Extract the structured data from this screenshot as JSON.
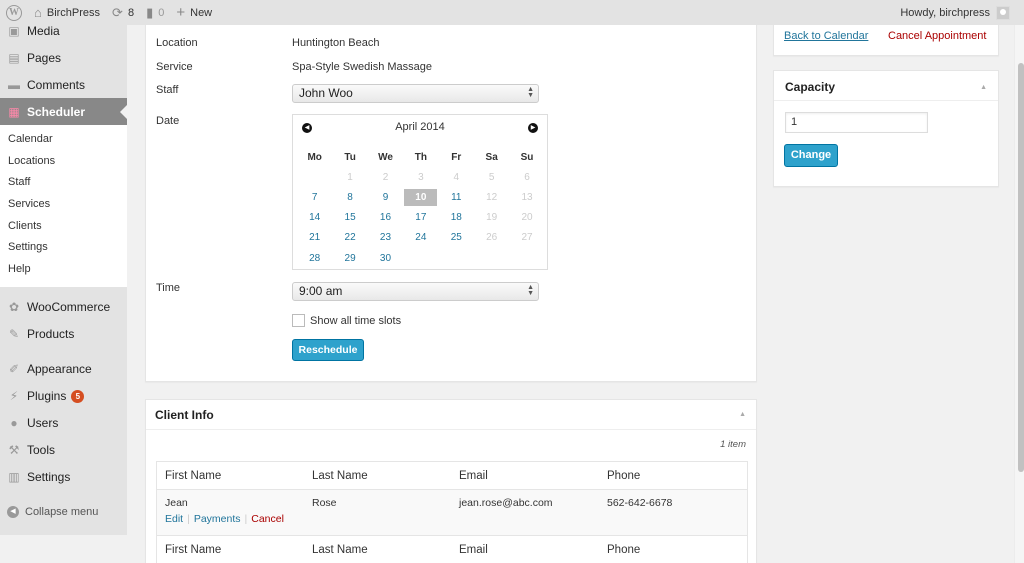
{
  "adminbar": {
    "site_name": "BirchPress",
    "updates_count": "8",
    "comments_count": "0",
    "new_label": "New",
    "howdy": "Howdy, birchpress"
  },
  "sidebar": {
    "top_items": [
      {
        "label": "Media",
        "icon": "media-icon"
      },
      {
        "label": "Pages",
        "icon": "pages-icon"
      },
      {
        "label": "Comments",
        "icon": "comments-icon"
      }
    ],
    "current": {
      "label": "Scheduler",
      "icon": "calendar-icon"
    },
    "submenu": [
      "Calendar",
      "Locations",
      "Staff",
      "Services",
      "Clients",
      "Settings",
      "Help"
    ],
    "group2": [
      {
        "label": "WooCommerce",
        "icon": "gear-icon"
      },
      {
        "label": "Products",
        "icon": "pin-icon"
      }
    ],
    "group3": [
      {
        "label": "Appearance",
        "icon": "brush-icon"
      },
      {
        "label": "Plugins",
        "icon": "plug-icon",
        "badge": "5"
      },
      {
        "label": "Users",
        "icon": "user-icon"
      },
      {
        "label": "Tools",
        "icon": "wrench-icon"
      },
      {
        "label": "Settings",
        "icon": "settings-icon"
      }
    ],
    "collapse_label": "Collapse menu"
  },
  "appointment": {
    "location_label": "Location",
    "location_value": "Huntington Beach",
    "service_label": "Service",
    "service_value": "Spa-Style Swedish Massage",
    "staff_label": "Staff",
    "staff_value": "John Woo",
    "date_label": "Date",
    "time_label": "Time",
    "time_value": "9:00 am",
    "show_all_label": "Show all time slots",
    "show_all_checked": false,
    "reschedule_label": "Reschedule"
  },
  "datepicker": {
    "month_label": "April 2014",
    "weekdays": [
      "Mo",
      "Tu",
      "We",
      "Th",
      "Fr",
      "Sa",
      "Su"
    ],
    "weeks": [
      [
        {
          "d": ""
        },
        {
          "d": "1",
          "disabled": true
        },
        {
          "d": "2",
          "disabled": true
        },
        {
          "d": "3",
          "disabled": true
        },
        {
          "d": "4",
          "disabled": true
        },
        {
          "d": "5",
          "disabled": true
        },
        {
          "d": "6",
          "disabled": true
        }
      ],
      [
        {
          "d": "7"
        },
        {
          "d": "8"
        },
        {
          "d": "9"
        },
        {
          "d": "10",
          "selected": true
        },
        {
          "d": "11"
        },
        {
          "d": "12",
          "disabled": true
        },
        {
          "d": "13",
          "disabled": true
        }
      ],
      [
        {
          "d": "14"
        },
        {
          "d": "15"
        },
        {
          "d": "16"
        },
        {
          "d": "17"
        },
        {
          "d": "18"
        },
        {
          "d": "19",
          "disabled": true
        },
        {
          "d": "20",
          "disabled": true
        }
      ],
      [
        {
          "d": "21"
        },
        {
          "d": "22"
        },
        {
          "d": "23"
        },
        {
          "d": "24"
        },
        {
          "d": "25"
        },
        {
          "d": "26",
          "disabled": true
        },
        {
          "d": "27",
          "disabled": true
        }
      ],
      [
        {
          "d": "28"
        },
        {
          "d": "29"
        },
        {
          "d": "30"
        },
        {
          "d": ""
        },
        {
          "d": ""
        },
        {
          "d": ""
        },
        {
          "d": ""
        }
      ]
    ]
  },
  "client_info": {
    "title": "Client Info",
    "item_count": "1 item",
    "columns": [
      "First Name",
      "Last Name",
      "Email",
      "Phone"
    ],
    "rows": [
      {
        "first_name": "Jean",
        "last_name": "Rose",
        "email": "jean.rose@abc.com",
        "phone": "562-642-6678",
        "actions": [
          "Edit",
          "Payments",
          "Cancel"
        ]
      }
    ]
  },
  "actions": {
    "back_label": "Back to Calendar",
    "cancel_label": "Cancel Appointment"
  },
  "capacity": {
    "title": "Capacity",
    "value": "1",
    "change_label": "Change"
  },
  "scroll": {
    "thumb_start": 0.07,
    "thumb_end": 0.83
  }
}
